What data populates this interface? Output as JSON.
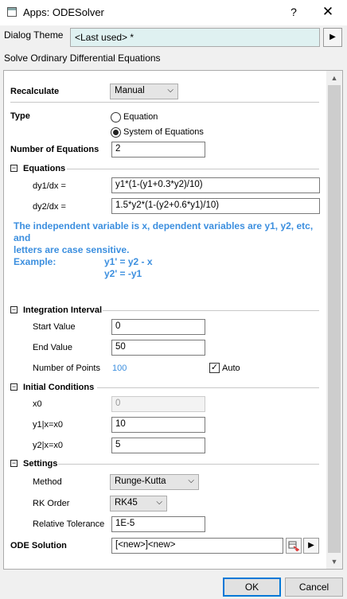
{
  "window": {
    "title": "Apps: ODESolver",
    "help": "?",
    "close": "✕"
  },
  "theme": {
    "label": "Dialog Theme",
    "value": "<Last used> *",
    "arrow": "▶"
  },
  "subtitle": "Solve Ordinary Differential Equations",
  "recalculate": {
    "label": "Recalculate",
    "value": "Manual"
  },
  "type": {
    "label": "Type",
    "option_equation": "Equation",
    "option_system": "System of Equations",
    "selected": "System of Equations"
  },
  "num_equations": {
    "label": "Number of Equations",
    "value": "2"
  },
  "equations": {
    "header": "Equations",
    "dy1_label": "dy1/dx =",
    "dy1_value": "y1*(1-(y1+0.3*y2)/10)",
    "dy2_label": "dy2/dx =",
    "dy2_value": "1.5*y2*(1-(y2+0.6*y1)/10)",
    "note_line1": "The independent variable is x, dependent variables are y1, y2, etc, and",
    "note_line2": "letters are case sensitive.",
    "note_line3": "Example:",
    "example_line1": "y1' = y2 - x",
    "example_line2": "y2' = -y1"
  },
  "integration": {
    "header": "Integration Interval",
    "start_label": "Start Value",
    "start_value": "0",
    "end_label": "End Value",
    "end_value": "50",
    "points_label": "Number of Points",
    "points_value": "100",
    "auto_label": "Auto",
    "auto_checked": true
  },
  "initial": {
    "header": "Initial Conditions",
    "x0_label": "x0",
    "x0_value": "0",
    "y1_label": "y1|x=x0",
    "y1_value": "10",
    "y2_label": "y2|x=x0",
    "y2_value": "5"
  },
  "settings": {
    "header": "Settings",
    "method_label": "Method",
    "method_value": "Runge-Kutta",
    "order_label": "RK Order",
    "order_value": "RK45",
    "tol_label": "Relative Tolerance",
    "tol_value": "1E-5"
  },
  "solution": {
    "label": "ODE Solution",
    "value": "[<new>]<new>"
  },
  "buttons": {
    "ok": "OK",
    "cancel": "Cancel"
  }
}
